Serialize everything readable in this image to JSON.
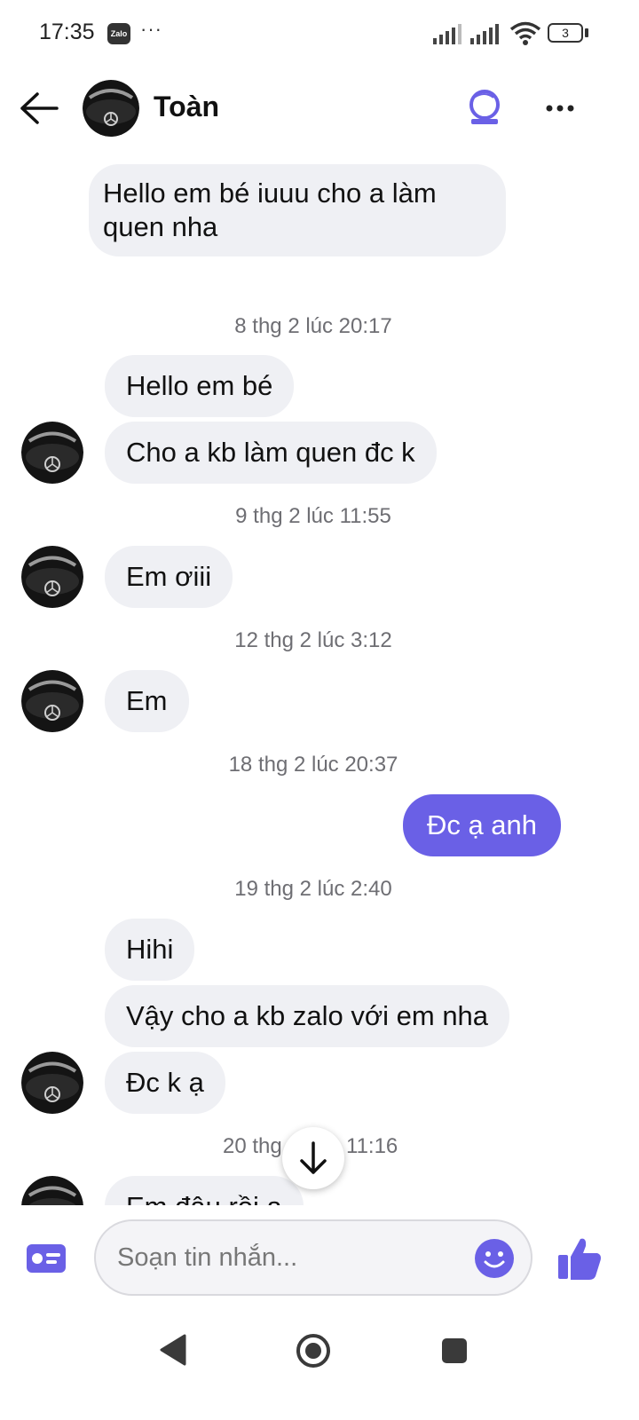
{
  "status_bar": {
    "time": "17:35",
    "app_badge": "Zalo",
    "dots": "···",
    "battery": "3"
  },
  "header": {
    "contact_name": "Toàn"
  },
  "messages": {
    "m0": "Hello em bé iuuu cho a làm",
    "m0b": "quen nha",
    "ts1": "8 thg 2 lúc 20:17",
    "m1": "Hello em bé",
    "m2": "Cho a kb làm quen đc k",
    "ts2": "9 thg 2 lúc 11:55",
    "m3": "Em ơiii",
    "ts3": "12 thg 2 lúc 3:12",
    "m4": "Em",
    "ts4": "18 thg 2 lúc 20:37",
    "m5": "Đc ạ anh",
    "ts5": "19 thg 2 lúc 2:40",
    "m6": "Hihi",
    "m7": "Vậy cho a kb zalo với em nha",
    "m8": "Đc k ạ",
    "ts6_left": "20 thg",
    "ts6_right": "11:16",
    "m9": "Em đâu rồi ạ"
  },
  "composer": {
    "placeholder": "Soạn tin nhắn..."
  },
  "colors": {
    "accent": "#6a60e6",
    "incoming_bubble": "#eff0f4",
    "timestamp": "#6e6e73"
  },
  "icons": {
    "back": "back-arrow-icon",
    "call": "video-call-icon",
    "more": "more-dots-icon",
    "scroll": "arrow-down-icon",
    "contact_card": "contact-card-icon",
    "emoji": "emoji-icon",
    "like": "thumbs-up-icon"
  }
}
